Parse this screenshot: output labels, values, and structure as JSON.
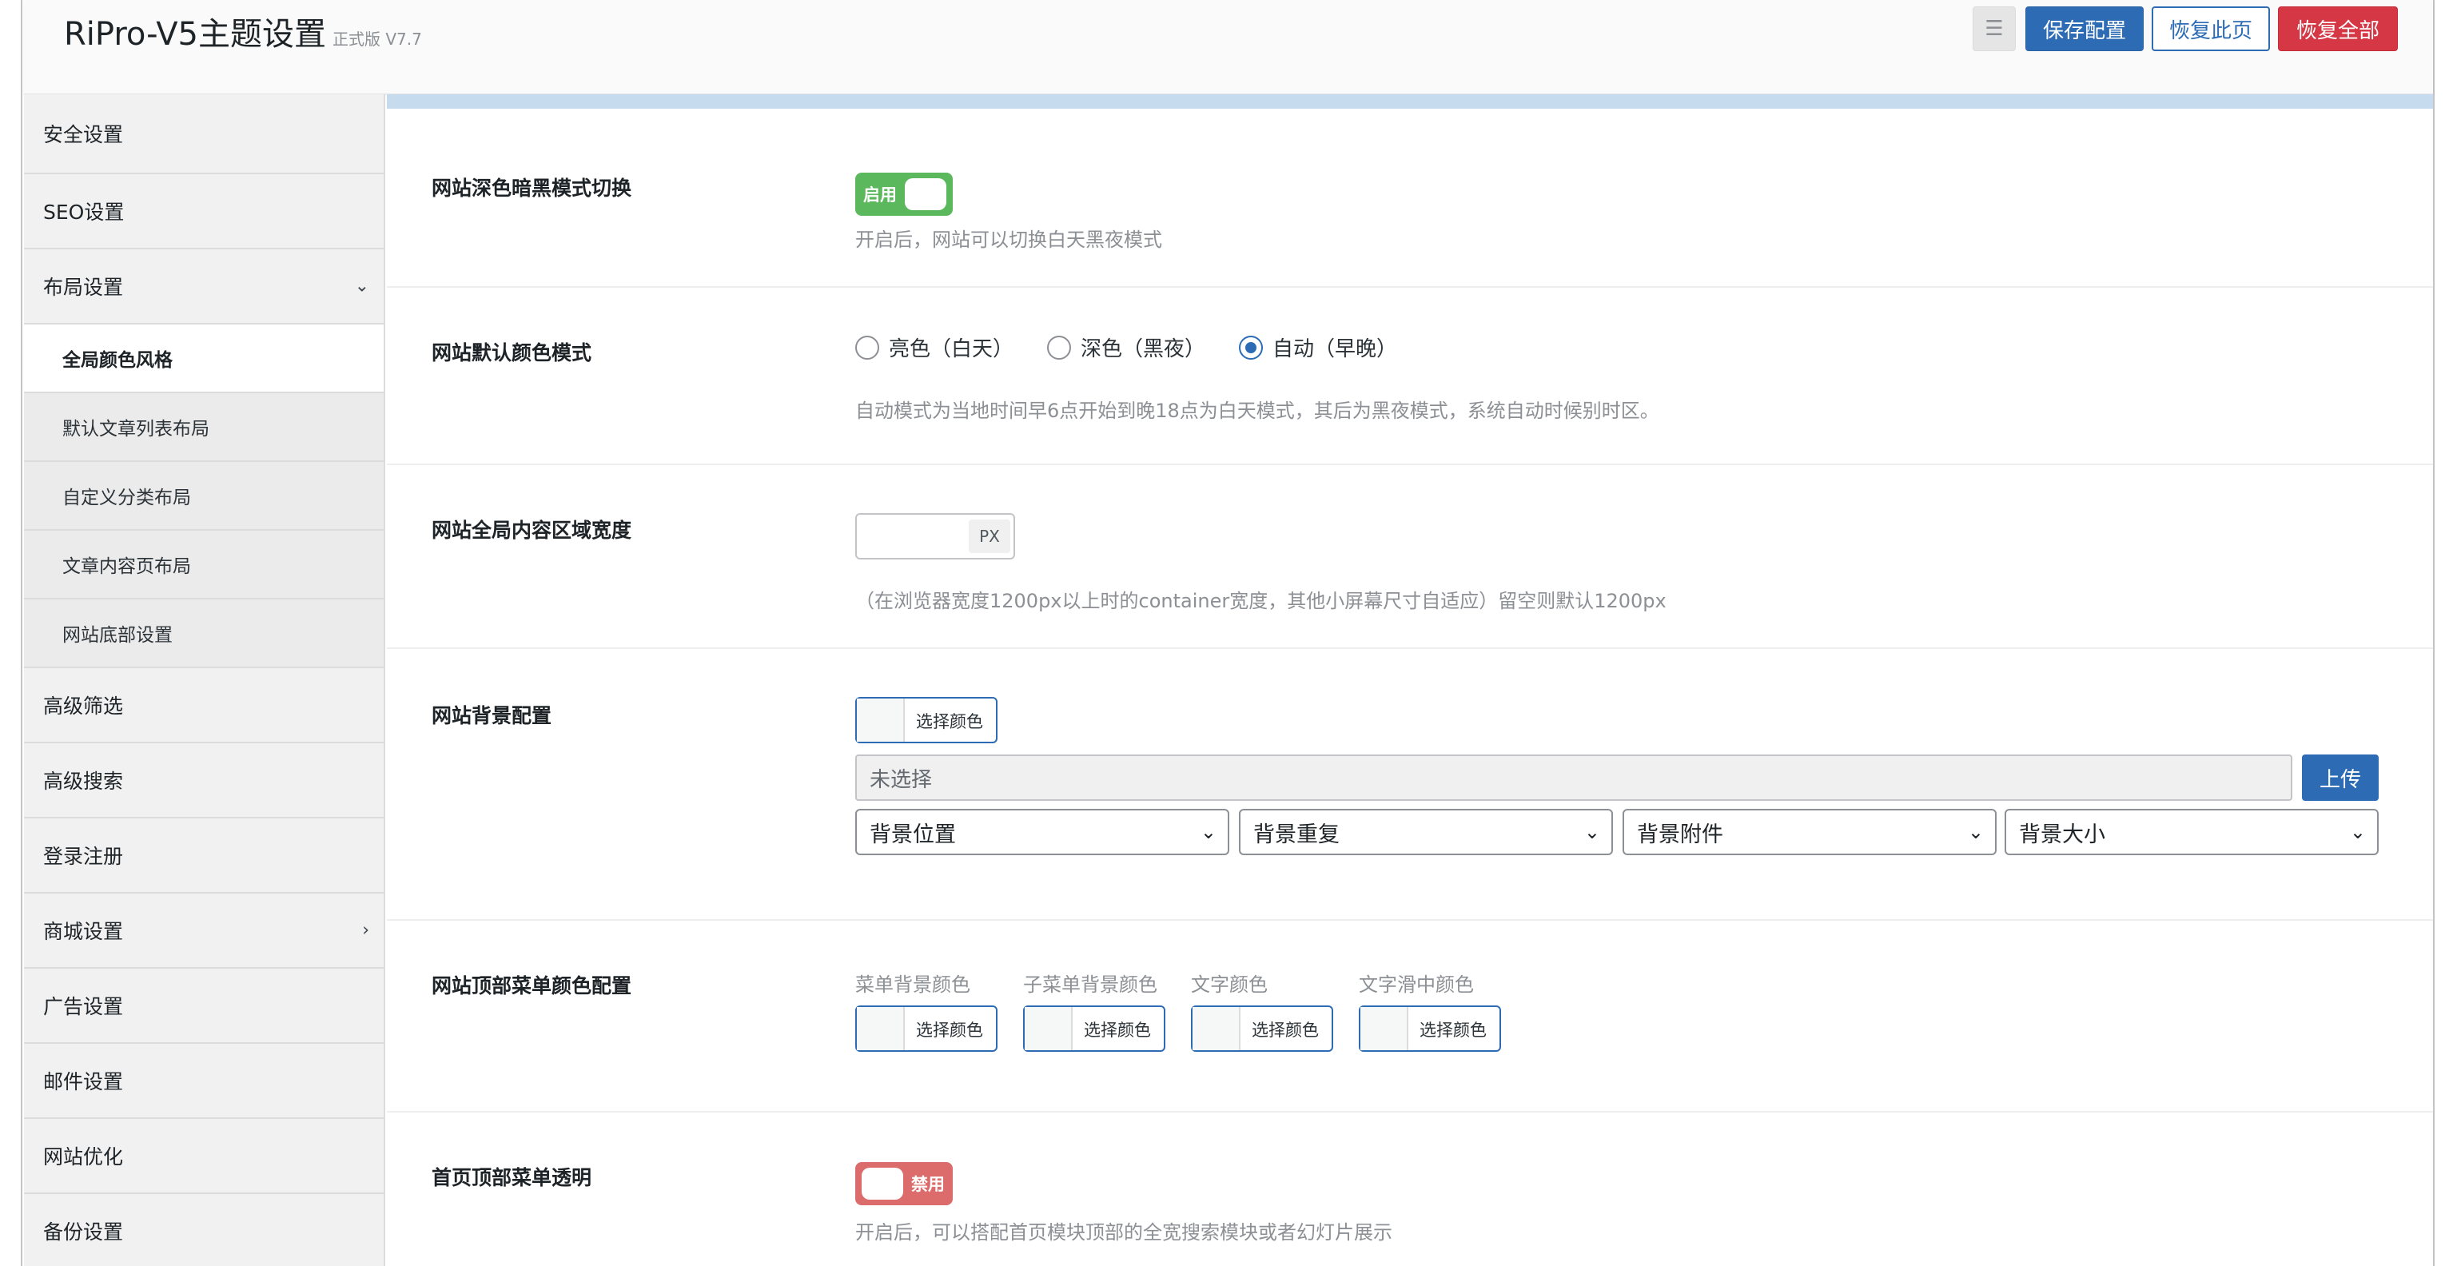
{
  "header": {
    "title": "RiPro-V5主题设置",
    "version": "正式版 V7.7",
    "collapse_icon": "☰",
    "save_label": "保存配置",
    "reset_page_label": "恢复此页",
    "reset_all_label": "恢复全部"
  },
  "sidebar": {
    "items": [
      {
        "label": "安全设置"
      },
      {
        "label": "SEO设置"
      },
      {
        "label": "布局设置",
        "chevron": "⌄"
      },
      {
        "label": "全局颜色风格"
      },
      {
        "label": "默认文章列表布局"
      },
      {
        "label": "自定义分类布局"
      },
      {
        "label": "文章内容页布局"
      },
      {
        "label": "网站底部设置"
      },
      {
        "label": "高级筛选"
      },
      {
        "label": "高级搜索"
      },
      {
        "label": "登录注册"
      },
      {
        "label": "商城设置",
        "chevron": "›"
      },
      {
        "label": "广告设置"
      },
      {
        "label": "邮件设置"
      },
      {
        "label": "网站优化"
      },
      {
        "label": "备份设置"
      }
    ]
  },
  "main": {
    "dark_mode": {
      "label": "网站深色暗黑模式切换",
      "toggle_text": "启用",
      "help": "开启后，网站可以切换白天黑夜模式"
    },
    "color_mode": {
      "label": "网站默认颜色模式",
      "options": [
        "亮色（白天）",
        "深色（黑夜）",
        "自动（早晚）"
      ],
      "help": "自动模式为当地时间早6点开始到晚18点为白天模式，其后为黑夜模式，系统自动时候别时区。"
    },
    "content_width": {
      "label": "网站全局内容区域宽度",
      "unit": "PX",
      "help": "（在浏览器宽度1200px以上时的container宽度，其他小屏幕尺寸自适应）留空则默认1200px"
    },
    "background": {
      "label": "网站背景配置",
      "color_button": "选择颜色",
      "file_placeholder": "未选择",
      "upload_label": "上传",
      "selects": [
        "背景位置",
        "背景重复",
        "背景附件",
        "背景大小"
      ]
    },
    "menu_colors": {
      "label": "网站顶部菜单颜色配置",
      "items": [
        {
          "label": "菜单背景颜色",
          "button": "选择颜色"
        },
        {
          "label": "子菜单背景颜色",
          "button": "选择颜色"
        },
        {
          "label": "文字颜色",
          "button": "选择颜色"
        },
        {
          "label": "文字滑中颜色",
          "button": "选择颜色"
        }
      ]
    },
    "menu_transparent": {
      "label": "首页顶部菜单透明",
      "toggle_text": "禁用",
      "help": "开启后，可以搭配首页模块顶部的全宽搜索模块或者幻灯片展示"
    }
  },
  "colors": {
    "primary": "#2d6cb5",
    "danger": "#d63745",
    "enabled": "#5cb85c",
    "disabled": "#dc6b6b"
  }
}
